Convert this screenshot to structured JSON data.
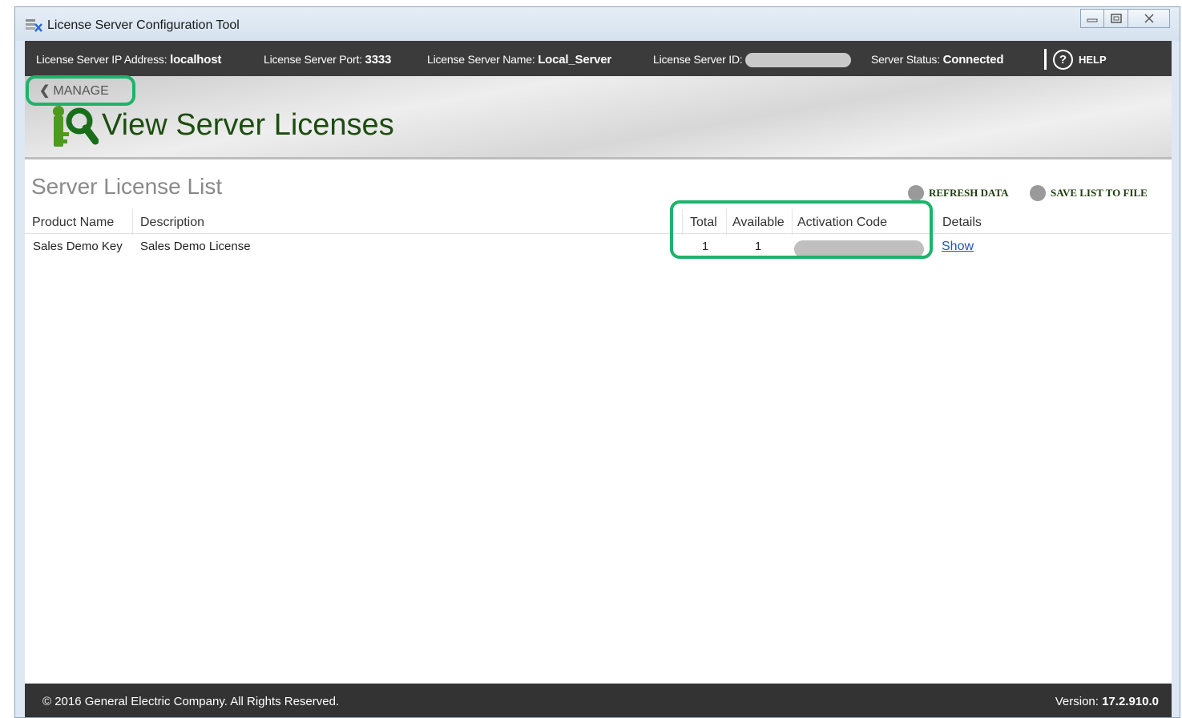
{
  "window": {
    "title": "License Server Configuration Tool",
    "controls": {
      "minimize": "▭",
      "maximize": "□",
      "close": "✕"
    }
  },
  "infobar": {
    "ip_label": "License Server IP Address:",
    "ip_value": "localhost",
    "port_label": "License Server Port:",
    "port_value": "3333",
    "name_label": "License Server Name:",
    "name_value": "Local_Server",
    "id_label": "License Server ID:",
    "status_label": "Server Status:",
    "status_value": "Connected",
    "help_icon": "?",
    "help_label": "HELP"
  },
  "header": {
    "manage_label": "MANAGE",
    "manage_icon": "chevron-left",
    "page_title": "View Server Licenses",
    "page_icon": "keys-magnifier"
  },
  "list": {
    "title": "Server License List",
    "actions": {
      "refresh": "REFRESH DATA",
      "save": "SAVE LIST TO FILE"
    },
    "columns": [
      "Product Name",
      "Description",
      "Total",
      "Available",
      "Activation Code",
      "Details"
    ],
    "rows": [
      {
        "product_name": "Sales Demo Key",
        "description": "Sales Demo License",
        "total": "1",
        "available": "1",
        "details": "Show"
      }
    ]
  },
  "footer": {
    "copyright": "© 2016 General Electric Company.  All Rights Reserved.",
    "version_label": "Version:",
    "version_value": "17.2.910.0"
  },
  "colors": {
    "highlight": "#1db36a",
    "title_green": "#1d4d0f",
    "link_blue": "#1f55b8",
    "dark_bar": "#3b3b3b"
  }
}
